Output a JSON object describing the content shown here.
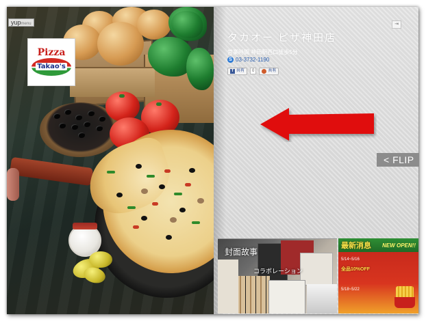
{
  "widget": {
    "brand_main": "yup",
    "brand_sub": "menu"
  },
  "logo": {
    "line1": "Pizza",
    "line2": "Takao's"
  },
  "shop": {
    "name": "タカオー ピザ神田店",
    "address": "営業時間 神田駅西口徒歩5分",
    "phone": "03-3732-1190"
  },
  "share": {
    "facebook_label": "共有",
    "count": "0",
    "plurk_label": "共有"
  },
  "flip": {
    "label": "< FLIP"
  },
  "corner_button": {
    "label": "⇥"
  },
  "thumbnails": [
    {
      "title": "封面故事",
      "subtitle": "コラボレーション"
    },
    {
      "title": "最新消息",
      "badge": "NEW OPEN!!",
      "line1": "5/14~5/16",
      "highlight1": "全品10%OFF",
      "line2": "5/18~5/22"
    }
  ],
  "colors": {
    "arrow": "#e01010",
    "flip_bg": "#8c8c8c",
    "info_text": "#ffffff",
    "phone_link": "#2a5fb0"
  }
}
